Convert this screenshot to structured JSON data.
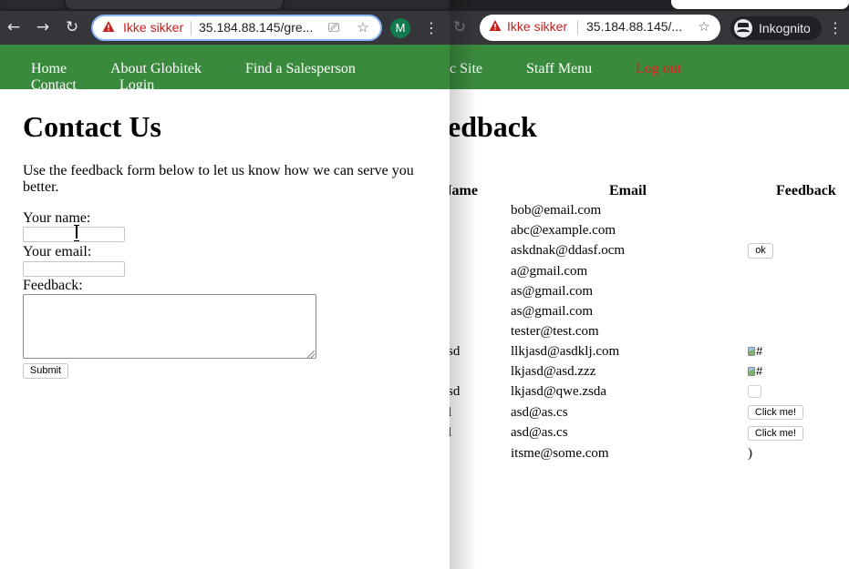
{
  "left_window": {
    "address_bar": {
      "security_label": "Ikke sikker",
      "url": "35.184.88.145/gre..."
    },
    "profile_initial": "M",
    "nav": [
      {
        "label": "Home"
      },
      {
        "label": "About Globitek"
      },
      {
        "label": "Find a Salesperson"
      },
      {
        "label": "Contact"
      },
      {
        "label": "Login"
      }
    ],
    "page_title": "Contact Us",
    "intro": "Use the feedback form below to let us know how we can serve you better.",
    "form": {
      "name_label": "Your name:",
      "name_value": "",
      "email_label": "Your email:",
      "email_value": "",
      "feedback_label": "Feedback:",
      "feedback_value": "",
      "submit_label": "Submit"
    }
  },
  "right_window": {
    "address_bar": {
      "security_label": "Ikke sikker",
      "url": "35.184.88.145/..."
    },
    "incognito_label": "Inkognito",
    "nav": [
      {
        "label": "c Site"
      },
      {
        "label": "Staff Menu"
      },
      {
        "label": "Log out"
      }
    ],
    "page_title": "edback",
    "table": {
      "columns": [
        "Name",
        "Email",
        "Feedback"
      ],
      "rows": [
        {
          "name": "",
          "email": "bob@email.com",
          "feedback": ""
        },
        {
          "name": "",
          "email": "abc@example.com",
          "feedback": ""
        },
        {
          "name": "",
          "email": "askdnak@ddasf.ocm",
          "feedback": "ok"
        },
        {
          "name": "",
          "email": "a@gmail.com",
          "feedback": ""
        },
        {
          "name": "",
          "email": "as@gmail.com",
          "feedback": ""
        },
        {
          "name": "",
          "email": "as@gmail.com",
          "feedback": ""
        },
        {
          "name": "",
          "email": "tester@test.com",
          "feedback": ""
        },
        {
          "name": "sd",
          "email": "llkjasd@asdklj.com",
          "feedback": "#"
        },
        {
          "name": "",
          "email": "lkjasd@asd.zzz",
          "feedback": "#"
        },
        {
          "name": "sd",
          "email": "lkjasd@qwe.zsda",
          "feedback": ""
        },
        {
          "name": "l",
          "email": "asd@as.cs",
          "feedback": "Click me!"
        },
        {
          "name": "l",
          "email": "asd@as.cs",
          "feedback": "Click me!"
        },
        {
          "name": "",
          "email": "itsme@some.com",
          "feedback": ")"
        }
      ]
    }
  },
  "colors": {
    "nav_green": "#3a8a3e",
    "logout_red": "#e31e1e",
    "insecure_red": "#c5221f",
    "chrome_dark": "#35363a"
  }
}
